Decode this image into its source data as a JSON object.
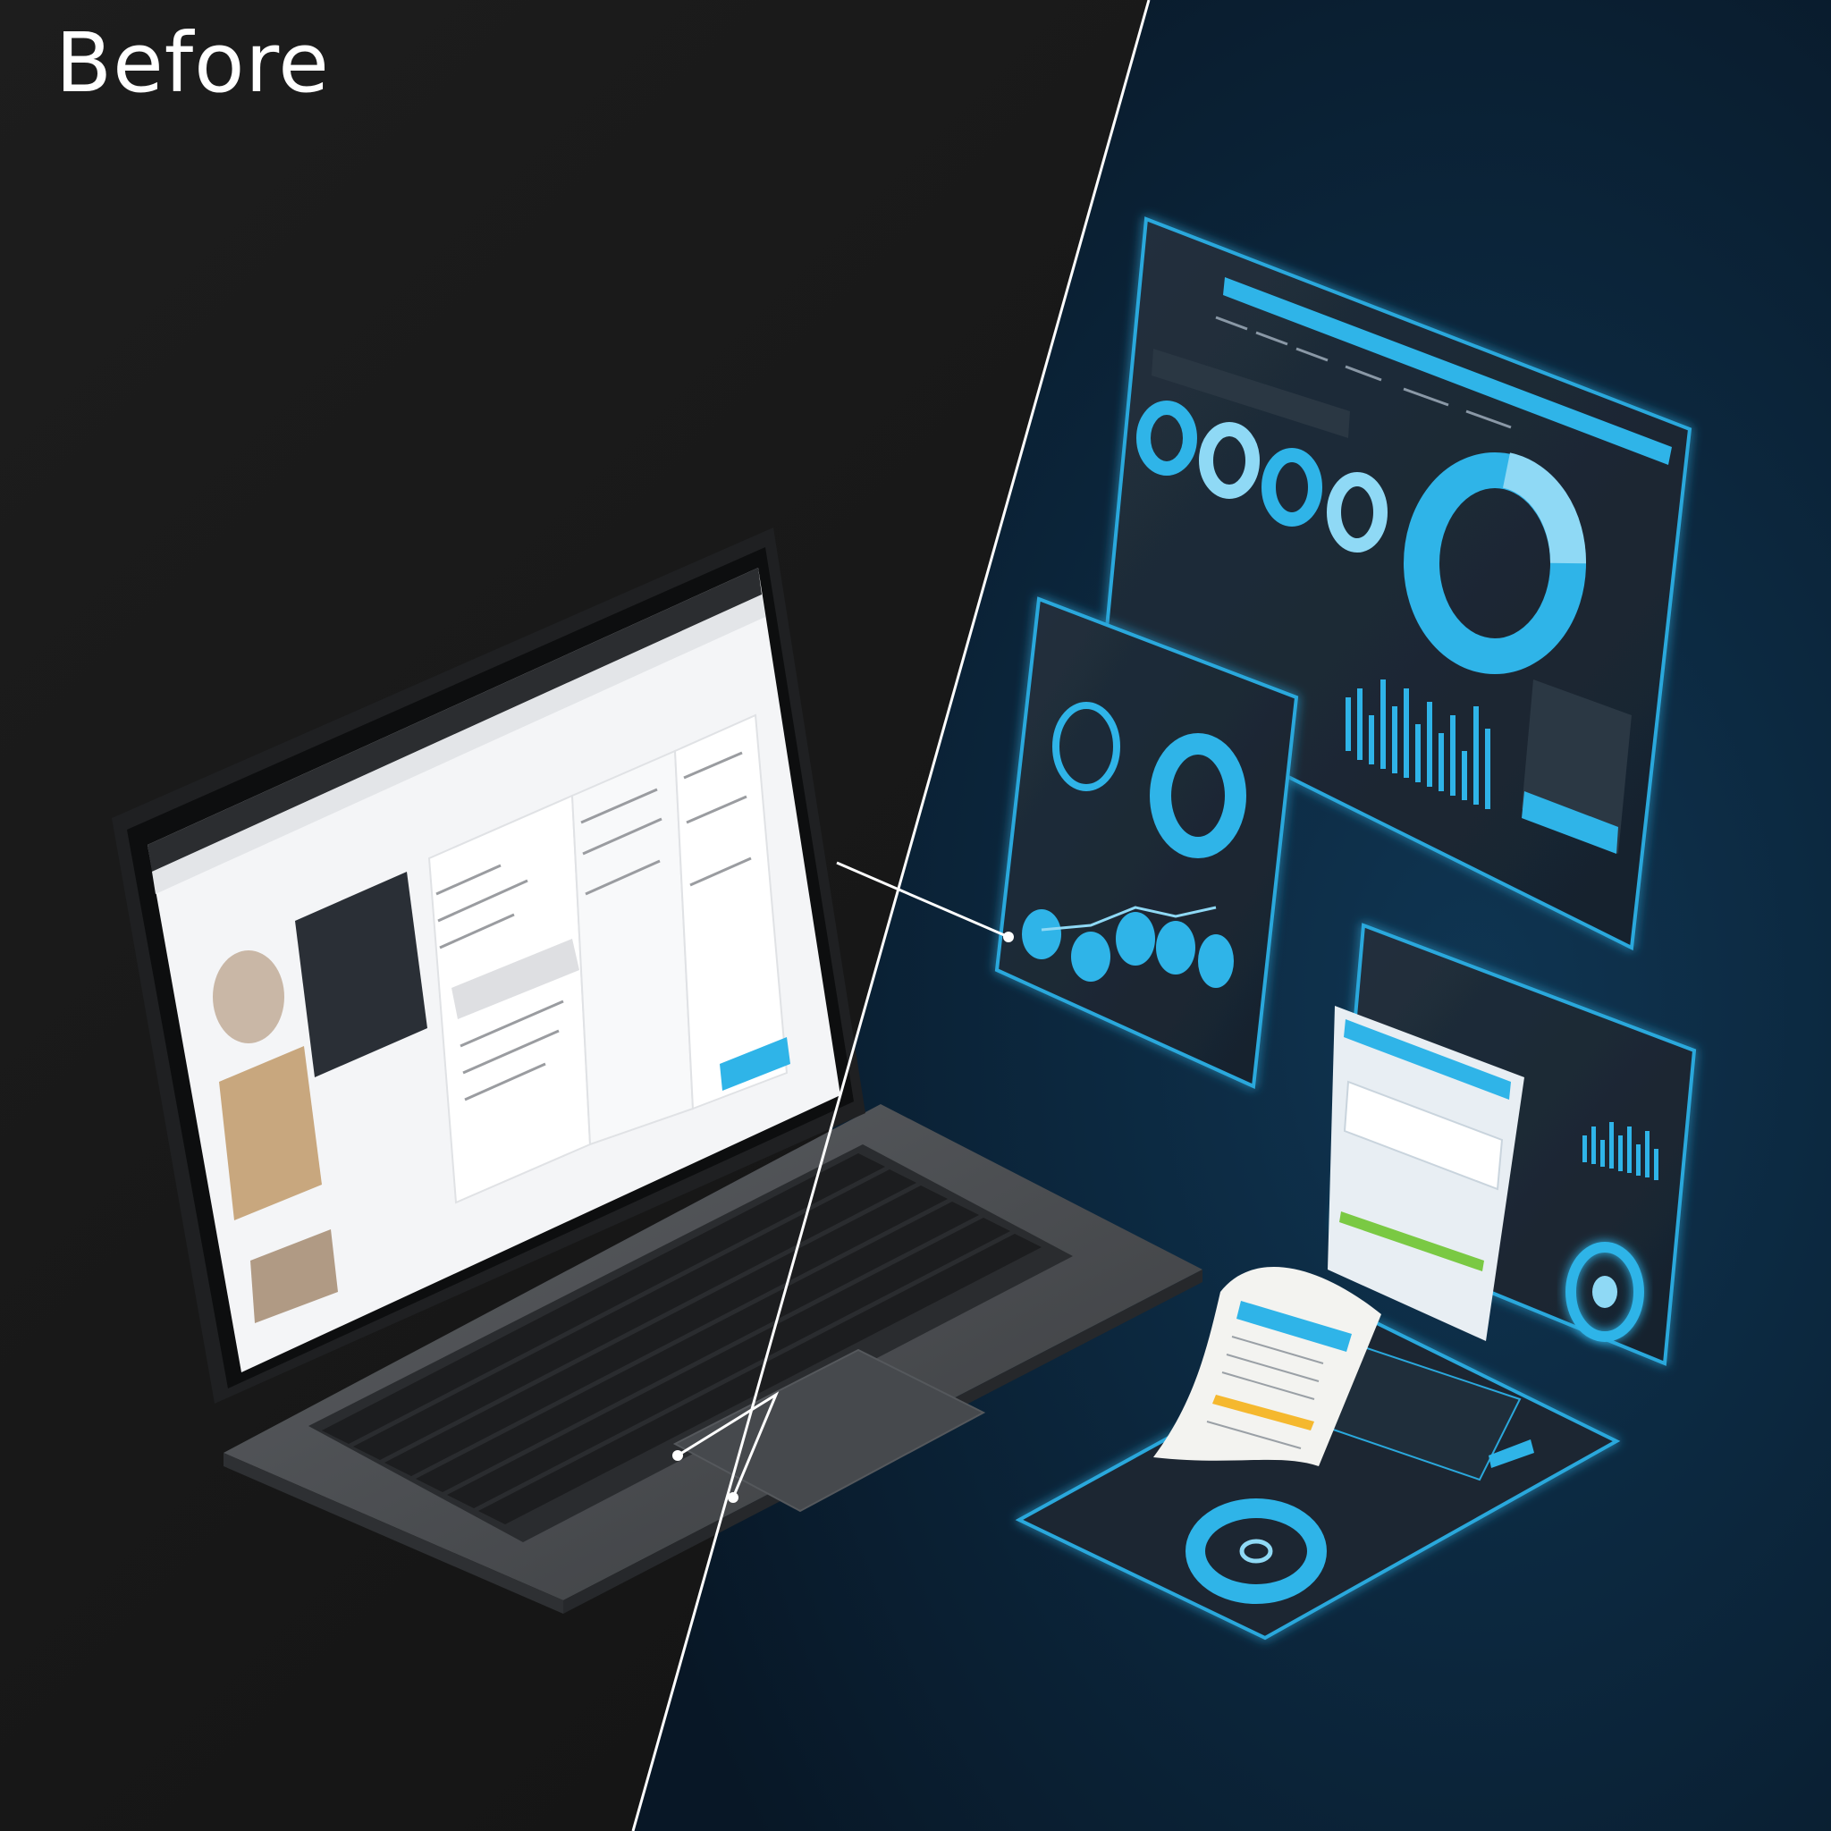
{
  "heading": {
    "before_label": "Before"
  },
  "colors": {
    "left_background": "#161616",
    "right_background": "#0b2236",
    "divider_line": "#ffffff",
    "laptop_body": "#505357",
    "keyboard_key": "#1c1d1f",
    "screen_content": "#f4f5f7",
    "panel_fill": "#1d2a36",
    "panel_edge": "#2aa8dc",
    "accent_cyan": "#2fb4e8",
    "accent_light": "#8fd9f5",
    "receipt_paper": "#f3f3f0"
  },
  "icons": [
    "laptop-illustration",
    "dashboard-panel",
    "tablet-panel",
    "receipt-icon",
    "donut-chart-icon",
    "bar-chart-icon"
  ]
}
